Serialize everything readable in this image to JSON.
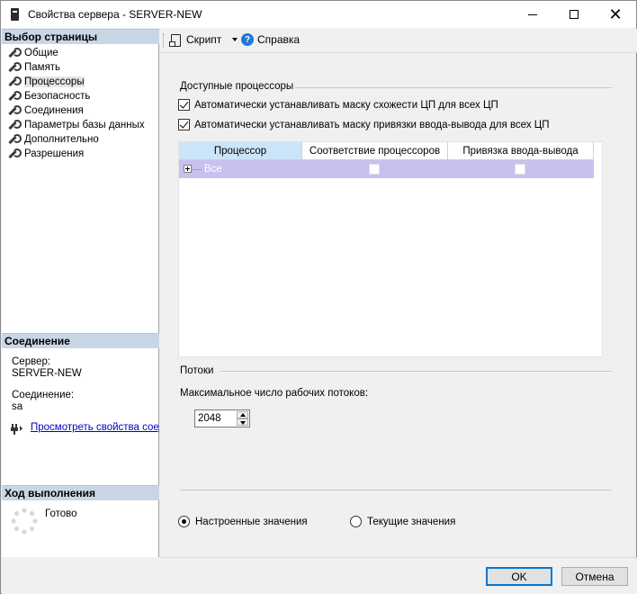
{
  "window": {
    "title": "Свойства сервера - SERVER-NEW"
  },
  "left_pane": {
    "select_page_header": "Выбор страницы",
    "pages": [
      {
        "label": "Общие",
        "active": false
      },
      {
        "label": "Память",
        "active": false
      },
      {
        "label": "Процессоры",
        "active": true
      },
      {
        "label": "Безопасность",
        "active": false
      },
      {
        "label": "Соединения",
        "active": false
      },
      {
        "label": "Параметры базы данных",
        "active": false
      },
      {
        "label": "Дополнительно",
        "active": false
      },
      {
        "label": "Разрешения",
        "active": false
      }
    ],
    "connection_header": "Соединение",
    "server_label": "Сервер:",
    "server_value": "SERVER-NEW",
    "connection_label": "Соединение:",
    "connection_value": "sa",
    "view_connection_link": "Просмотреть свойства соединения",
    "progress_header": "Ход выполнения",
    "progress_status": "Готово"
  },
  "toolbar": {
    "script_label": "Скрипт",
    "help_label": "Справка"
  },
  "processors": {
    "group_title": "Доступные процессоры",
    "auto_affinity_label": "Автоматически устанавливать маску схожести ЦП для всех ЦП",
    "auto_affinity_checked": true,
    "auto_io_affinity_label": "Автоматически устанавливать маску привязки ввода-вывода для всех ЦП",
    "auto_io_affinity_checked": true,
    "grid": {
      "columns": [
        "Процессор",
        "Соответствие процессоров",
        "Привязка ввода-вывода"
      ],
      "rows": [
        {
          "label": "Все",
          "affinity": false,
          "io_affinity": false
        }
      ]
    }
  },
  "threads": {
    "group_title": "Потоки",
    "max_worker_label": "Максимальное число рабочих потоков:",
    "max_worker_value": "2048"
  },
  "values_mode": {
    "configured_label": "Настроенные значения",
    "running_label": "Текущие значения",
    "selected": "configured"
  },
  "footer": {
    "ok_label": "OK",
    "cancel_label": "Отмена"
  },
  "colors": {
    "section_header_bg": "#c9d6e6",
    "selected_row_bg": "#c9c0f0",
    "selected_column_header_bg": "#cce4f7",
    "link": "#0000cc",
    "help_icon": "#1e79d8",
    "ok_border": "#0078d7"
  }
}
